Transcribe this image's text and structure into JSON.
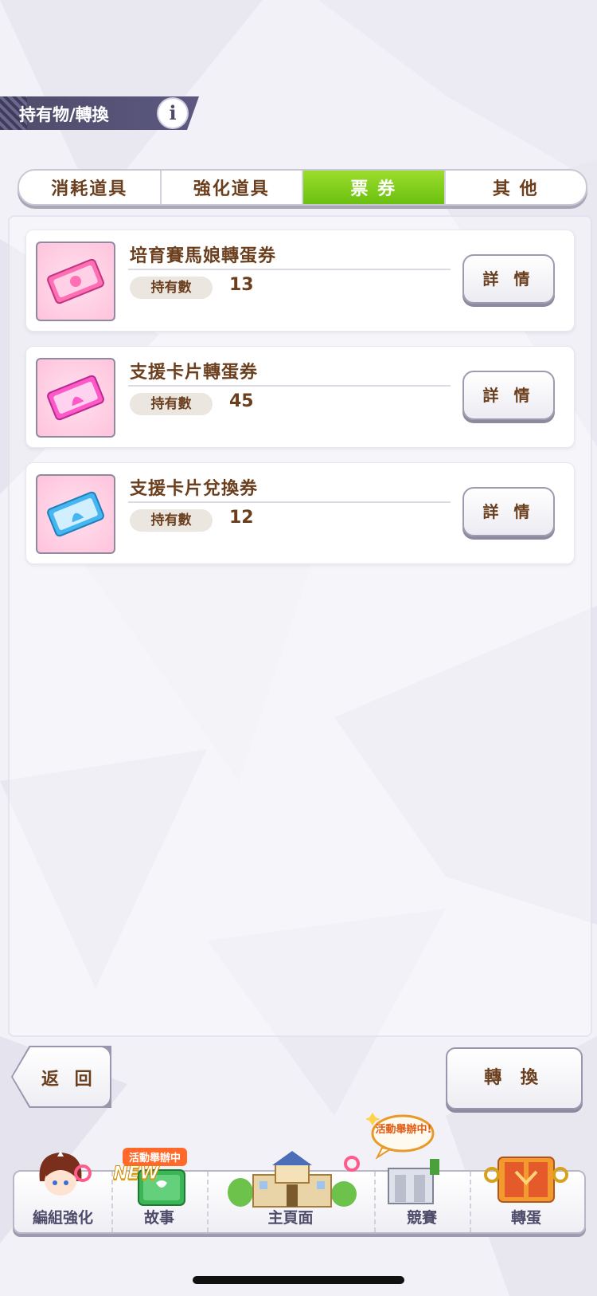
{
  "header": {
    "title": "持有物/轉換",
    "info_icon": "i"
  },
  "tabs": [
    {
      "label": "消耗道具",
      "active": false
    },
    {
      "label": "強化道具",
      "active": false
    },
    {
      "label": "票 券",
      "active": true
    },
    {
      "label": "其 他",
      "active": false
    }
  ],
  "items": [
    {
      "name": "培育賽馬娘轉蛋券",
      "own_label": "持有數",
      "count": "13",
      "detail_label": "詳 情",
      "ticket_color": "#ff6fb5"
    },
    {
      "name": "支援卡片轉蛋券",
      "own_label": "持有數",
      "count": "45",
      "detail_label": "詳 情",
      "ticket_color": "#ff58c8"
    },
    {
      "name": "支援卡片兌換券",
      "own_label": "持有數",
      "count": "12",
      "detail_label": "詳 情",
      "ticket_color": "#45b6f2"
    }
  ],
  "actions": {
    "back_label": "返 回",
    "convert_label": "轉 換"
  },
  "nav": {
    "items": [
      {
        "label": "編組強化",
        "icon": "character-portrait-icon"
      },
      {
        "label": "故事",
        "icon": "story-book-icon",
        "badge": "活動舉辦中",
        "new_tag": "NEW"
      },
      {
        "label": "主頁面",
        "icon": "school-building-icon"
      },
      {
        "label": "競賽",
        "icon": "race-gate-icon",
        "bubble": "活動舉辦中!"
      },
      {
        "label": "轉蛋",
        "icon": "gacha-gate-icon"
      }
    ]
  },
  "colors": {
    "accent_green": "#7ccb14",
    "text_brown": "#6b3f1e",
    "header_purple": "#4e4b6a"
  }
}
